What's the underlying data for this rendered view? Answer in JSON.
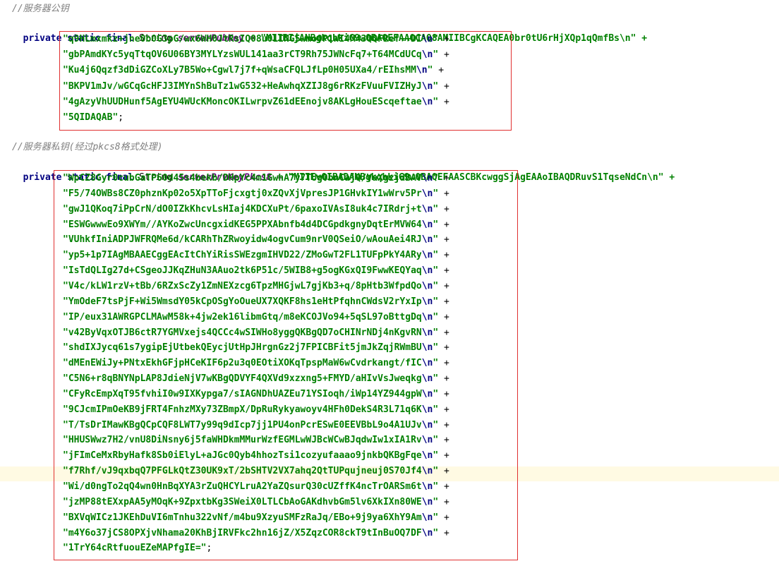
{
  "comment1": "//服务器公钥",
  "decl1": {
    "mods": "private static final",
    "type": "String",
    "name": "serverPubKey",
    "eq": " = ",
    "first": "\"MIIBIjANBgkqhkiG9w0BAQEFAAOCAQ8AMIIBCgKCAQEA0br0tU6rHjXQp1qQmfBs\\n\" +"
  },
  "pub_lines": [
    "\"q9HLmxmkz+jne0b0G3pG/wx6WH0JtRsIQ08u01ING5wmo0P1WI4M43QQFRef++DI\\n\" +",
    "\"gbPAmdKYc5yqTtqOV6U06BY3MYLYzsWUL141aa3rCT9Rh75JWNcFq7+T64MCdUCq\\n\" +",
    "\"Ku4j6Qqzf3dDiGZCoXLy7B5Wo+Cgwl7j7f+qWsaCFQLJfLp0H05UXa4/rEIhsMM\\n\" +",
    "\"BKPV1mJv/wGCqGcHFJ3IMYnShBuTz1wG532+HeAwhqXZIJ8g6rRKzFVuuFVIZHyJ\\n\" +",
    "\"4gAzyVhUUDHunf5AgEYU4WUcKMoncOKILwrpvZ61dEEnojv8AKLgHouEScqeftae\\n\" +",
    "\"5QIDAQAB\";"
  ],
  "comment2": "//服务器私钥(经过pkcs8格式处理)",
  "decl2": {
    "mods": "private static final",
    "type": "String",
    "name": "serverPrvKeyPkcs8",
    "eq": " = ",
    "first": "\"MIIEvQIBADANBgkqhkiG9w0BAQEFAASCBKcwggSjAgEAAoIBAQDRuvS1TqseNdCn\\n\" +"
  },
  "prv_lines": [
    "\"WpCZ8Gyr0cubGaTP60d45s4bekb/DHpYc4m1GwhA7y7TUg0bnCajQ/VaXgzjdBAV\\n\" +",
    "\"F5/74OWBs8CZ0phznKp02o5XpTToFjcxgtj0xZQvXjVpresJP1GHvkIY1wWrv5Pr\\n\" +",
    "\"gwJ1QKoq7iPpCrN/dO0IZkKhcvLsHIaj4KDCXuPt/6paxoIVAsI8uk4c7IRdrj+t\\n\" +",
    "\"ESWGwwwEo9XWYm//AYKoZwcUncgxidKEG5PPXAbnfb4d4DCGpdkgnyDqtErMVW64\\n\" +",
    "\"VUhkfIniADPJWFRQMe6d/kCARhThZRwoyidw4ogvCum9nrV0QSeiO/wAouAei4RJ\\n\" +",
    "\"yp5+1p7IAgMBAAECggEAcItChYiRisSWEzgmIHVD22/ZMoGwT2FL1TUFpPkY4ARy\\n\" +",
    "\"IsTdQLIg27d+CSgeoJJKqZHuN3AAuo2tk6P51c/5WIB8+g5ogKGxQI9FwwKEQYaq\\n\" +",
    "\"V4c/kLW1rzV+tBb/6RZxScZy1ZmNEXzcg6TpzMHGjwL7gjKb3+q/8pHtb3WfpdQo\\n\" +",
    "\"YmOdeF7tsPjF+Wi5WmsdY05kCpOSgYoOueUX7XQKF8hs1eHtPfqhnCWdsV2rYxIp\\n\" +",
    "\"IP/eux31AWRGPCLMAwM58k+4jw2ek16libmGtq/m8eKCOJVo94+5qSL97oBttgDq\\n\" +",
    "\"v42ByVqxOTJB6ctR7YGMVxejs4QCCc4wSIWHo8yggQKBgQD7oCHINrNDj4nKgvRN\\n\" +",
    "\"shdIXJycq61s7ygipEjUtbekQEycjUtHpJHrgnGz2j7FPICBFit5jmJkZqjRWmBU\\n\" +",
    "\"dMEnEWiJy+PNtxEkhGFjpHCeKIF6p2u3q0EOtiXOKqTpspMaW6wCvdrkangt/fIC\\n\" +",
    "\"C5N6+r8qBNYNpLAP8JdieNjV7wKBgQDVYF4QXVd9xzxng5+FMYD/aHIvVsJweqkg\\n\" +",
    "\"CFyRcEmpXqT95fvhiI0w9IXKypga7/sIAGNDhUAZEu71YSIoqh/iWp14YZ944gpW\\n\" +",
    "\"9CJcmIPmOeKB9jFRT4FnhzMXy73ZBmpX/DpRuRykyawoyv4HFh0DekS4R3L71q6K\\n\" +",
    "\"T/TsDrIMawKBgQCpCQF8LWT7y99q9dIcp7jj1PU4onPcrESwE0EEVBbL9o4A1UJv\\n\" +",
    "\"HHUSWwz7H2/vnU8DiNsny6j5faWHDkmMMurWzfEGMLwWJBcWCwBJqdwIw1xIA1Rv\\n\" +",
    "\"jFImCeMxRbyHafk8Sb0iElyL+aJGc0Qyb4hhozTsi1cozyufaaao9jnkbQKBgFqe\\n\" +",
    "\"f7Rhf/vJ9qxbqQ7PFGLkQtZ30UK9xT/2bSHTV2VX7ahq2QtTUPqujneuj0S70Jf4\\n\" +",
    "\"Wi/d0ngTo2qQ4wn0HnBqXYA3rZuQHCYLruA2YaZQsurQ30cUZffK4ncTrOARSm6t\\n\" +",
    "\"jzMP88tEXxpAA5yMOqK+9ZpxtbKg3SWeiX0LTLCbAoGAKdhvbGm5lv6XkIXn80WE\\n\" +",
    "\"BXVqWICz1JKEhDuVI6mTnhu322vNf/m4bu9XzyuSMFzRaJq/EBo+9j9ya6XhY9Am\\n\" +",
    "\"m4Y6o37jCS8OPXjvNhama20KhBjIRVFkc2hn16jZ/X5ZqzCOR8ckT9tInBuOQ7DF\\n\" +",
    "\"1TrY64cRtfuouEZeMAPfgIE=\";"
  ]
}
